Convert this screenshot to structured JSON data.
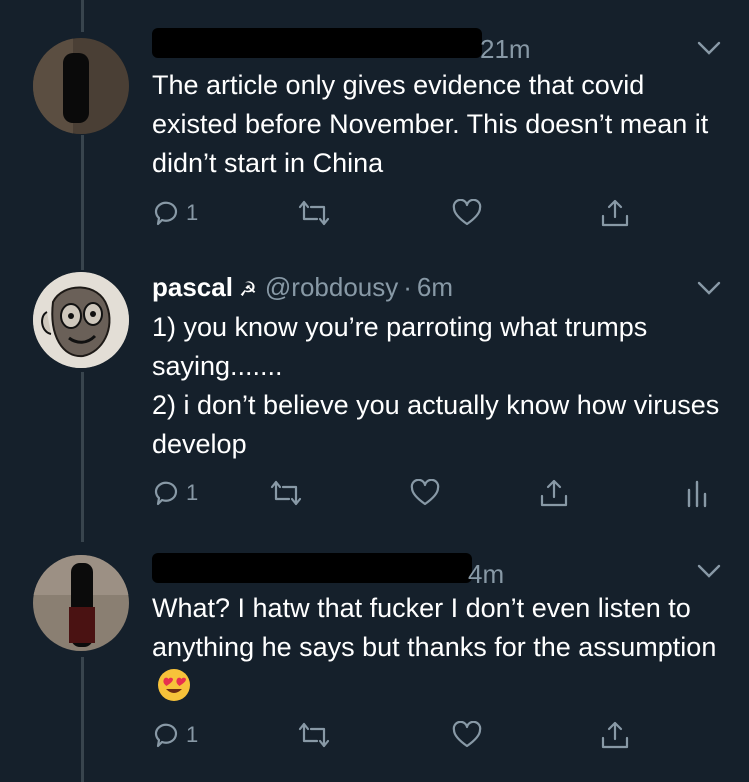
{
  "tweets": [
    {
      "name": "",
      "handle_time": "21m",
      "text": "The article only gives evidence that covid existed before November. This doesn’t mean it didn’t start in China",
      "reply_count": "1"
    },
    {
      "name": "pascal",
      "name_symbol": "☭",
      "handle": "@robdousy",
      "separator": "·",
      "time": "6m",
      "text": "1) you know you’re parroting what trumps saying.......\n2) i don’t believe you actually know how viruses develop",
      "reply_count": "1"
    },
    {
      "name": "",
      "handle_time": "4m",
      "text": "What? I hatw that fucker I don’t even listen to anything he says but thanks for the assumption",
      "emoji": "heart-eyes-emoji",
      "reply_count": "1"
    }
  ],
  "colors": {
    "background": "#15202b",
    "secondary_text": "#8899a6",
    "primary_text": "#ffffff",
    "thread_line": "#38444d"
  },
  "icons": [
    "reply-icon",
    "retweet-icon",
    "like-icon",
    "share-icon",
    "analytics-icon",
    "chevron-down-icon"
  ]
}
